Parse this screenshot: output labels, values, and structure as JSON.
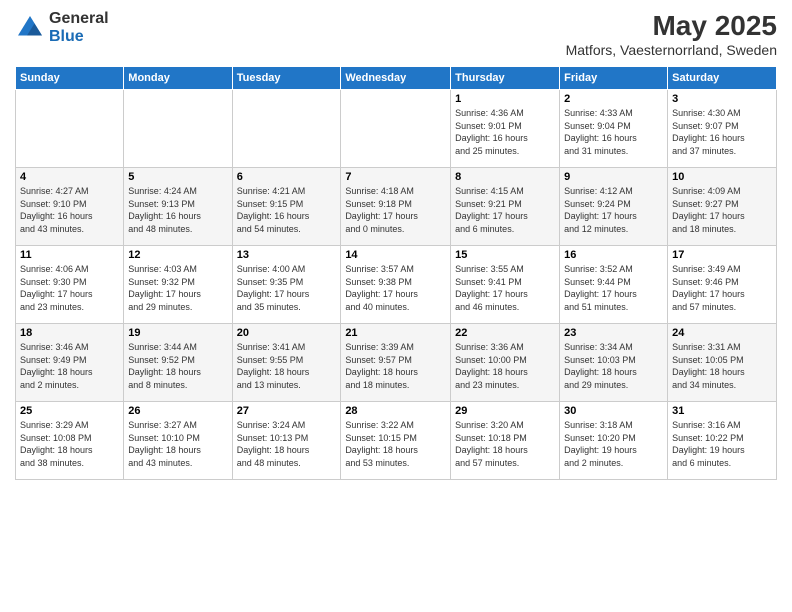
{
  "logo": {
    "general": "General",
    "blue": "Blue"
  },
  "title": "May 2025",
  "subtitle": "Matfors, Vaesternorrland, Sweden",
  "days_of_week": [
    "Sunday",
    "Monday",
    "Tuesday",
    "Wednesday",
    "Thursday",
    "Friday",
    "Saturday"
  ],
  "weeks": [
    [
      {
        "day": "",
        "info": ""
      },
      {
        "day": "",
        "info": ""
      },
      {
        "day": "",
        "info": ""
      },
      {
        "day": "",
        "info": ""
      },
      {
        "day": "1",
        "info": "Sunrise: 4:36 AM\nSunset: 9:01 PM\nDaylight: 16 hours\nand 25 minutes."
      },
      {
        "day": "2",
        "info": "Sunrise: 4:33 AM\nSunset: 9:04 PM\nDaylight: 16 hours\nand 31 minutes."
      },
      {
        "day": "3",
        "info": "Sunrise: 4:30 AM\nSunset: 9:07 PM\nDaylight: 16 hours\nand 37 minutes."
      }
    ],
    [
      {
        "day": "4",
        "info": "Sunrise: 4:27 AM\nSunset: 9:10 PM\nDaylight: 16 hours\nand 43 minutes."
      },
      {
        "day": "5",
        "info": "Sunrise: 4:24 AM\nSunset: 9:13 PM\nDaylight: 16 hours\nand 48 minutes."
      },
      {
        "day": "6",
        "info": "Sunrise: 4:21 AM\nSunset: 9:15 PM\nDaylight: 16 hours\nand 54 minutes."
      },
      {
        "day": "7",
        "info": "Sunrise: 4:18 AM\nSunset: 9:18 PM\nDaylight: 17 hours\nand 0 minutes."
      },
      {
        "day": "8",
        "info": "Sunrise: 4:15 AM\nSunset: 9:21 PM\nDaylight: 17 hours\nand 6 minutes."
      },
      {
        "day": "9",
        "info": "Sunrise: 4:12 AM\nSunset: 9:24 PM\nDaylight: 17 hours\nand 12 minutes."
      },
      {
        "day": "10",
        "info": "Sunrise: 4:09 AM\nSunset: 9:27 PM\nDaylight: 17 hours\nand 18 minutes."
      }
    ],
    [
      {
        "day": "11",
        "info": "Sunrise: 4:06 AM\nSunset: 9:30 PM\nDaylight: 17 hours\nand 23 minutes."
      },
      {
        "day": "12",
        "info": "Sunrise: 4:03 AM\nSunset: 9:32 PM\nDaylight: 17 hours\nand 29 minutes."
      },
      {
        "day": "13",
        "info": "Sunrise: 4:00 AM\nSunset: 9:35 PM\nDaylight: 17 hours\nand 35 minutes."
      },
      {
        "day": "14",
        "info": "Sunrise: 3:57 AM\nSunset: 9:38 PM\nDaylight: 17 hours\nand 40 minutes."
      },
      {
        "day": "15",
        "info": "Sunrise: 3:55 AM\nSunset: 9:41 PM\nDaylight: 17 hours\nand 46 minutes."
      },
      {
        "day": "16",
        "info": "Sunrise: 3:52 AM\nSunset: 9:44 PM\nDaylight: 17 hours\nand 51 minutes."
      },
      {
        "day": "17",
        "info": "Sunrise: 3:49 AM\nSunset: 9:46 PM\nDaylight: 17 hours\nand 57 minutes."
      }
    ],
    [
      {
        "day": "18",
        "info": "Sunrise: 3:46 AM\nSunset: 9:49 PM\nDaylight: 18 hours\nand 2 minutes."
      },
      {
        "day": "19",
        "info": "Sunrise: 3:44 AM\nSunset: 9:52 PM\nDaylight: 18 hours\nand 8 minutes."
      },
      {
        "day": "20",
        "info": "Sunrise: 3:41 AM\nSunset: 9:55 PM\nDaylight: 18 hours\nand 13 minutes."
      },
      {
        "day": "21",
        "info": "Sunrise: 3:39 AM\nSunset: 9:57 PM\nDaylight: 18 hours\nand 18 minutes."
      },
      {
        "day": "22",
        "info": "Sunrise: 3:36 AM\nSunset: 10:00 PM\nDaylight: 18 hours\nand 23 minutes."
      },
      {
        "day": "23",
        "info": "Sunrise: 3:34 AM\nSunset: 10:03 PM\nDaylight: 18 hours\nand 29 minutes."
      },
      {
        "day": "24",
        "info": "Sunrise: 3:31 AM\nSunset: 10:05 PM\nDaylight: 18 hours\nand 34 minutes."
      }
    ],
    [
      {
        "day": "25",
        "info": "Sunrise: 3:29 AM\nSunset: 10:08 PM\nDaylight: 18 hours\nand 38 minutes."
      },
      {
        "day": "26",
        "info": "Sunrise: 3:27 AM\nSunset: 10:10 PM\nDaylight: 18 hours\nand 43 minutes."
      },
      {
        "day": "27",
        "info": "Sunrise: 3:24 AM\nSunset: 10:13 PM\nDaylight: 18 hours\nand 48 minutes."
      },
      {
        "day": "28",
        "info": "Sunrise: 3:22 AM\nSunset: 10:15 PM\nDaylight: 18 hours\nand 53 minutes."
      },
      {
        "day": "29",
        "info": "Sunrise: 3:20 AM\nSunset: 10:18 PM\nDaylight: 18 hours\nand 57 minutes."
      },
      {
        "day": "30",
        "info": "Sunrise: 3:18 AM\nSunset: 10:20 PM\nDaylight: 19 hours\nand 2 minutes."
      },
      {
        "day": "31",
        "info": "Sunrise: 3:16 AM\nSunset: 10:22 PM\nDaylight: 19 hours\nand 6 minutes."
      }
    ]
  ]
}
